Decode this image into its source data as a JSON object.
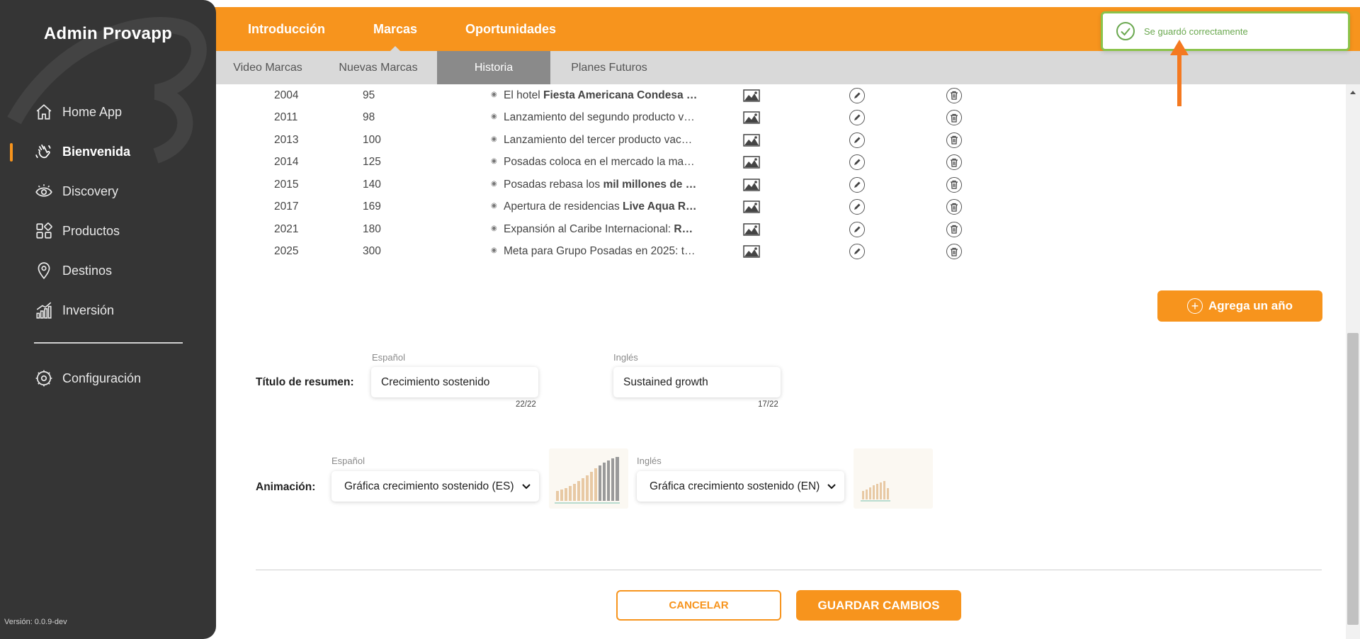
{
  "sidebar": {
    "brand": "Admin Provapp",
    "items": [
      {
        "label": "Home App",
        "icon": "home-icon"
      },
      {
        "label": "Bienvenida",
        "icon": "waving-hand-icon",
        "active": true
      },
      {
        "label": "Discovery",
        "icon": "eye-icon"
      },
      {
        "label": "Productos",
        "icon": "grid-icon"
      },
      {
        "label": "Destinos",
        "icon": "map-pin-icon"
      },
      {
        "label": "Inversión",
        "icon": "bar-chart-icon"
      }
    ],
    "config_label": "Configuración",
    "version": "Versión: 0.0.9-dev"
  },
  "header": {
    "tabs": [
      "Introducción",
      "Marcas",
      "Oportunidades"
    ],
    "active_tab": "Marcas",
    "subtabs": [
      "Video Marcas",
      "Nuevas Marcas",
      "Historia",
      "Planes Futuros"
    ],
    "active_subtab": "Historia"
  },
  "toast": {
    "message": "Se guardó correctamente",
    "color": "#8bc34a"
  },
  "timeline": [
    {
      "year": "2004",
      "value": "95",
      "text_plain": "El hotel ",
      "text_bold": "Fiesta Americana Condesa …"
    },
    {
      "year": "2011",
      "value": "98",
      "text_plain": "Lanzamiento del segundo producto v…",
      "text_bold": ""
    },
    {
      "year": "2013",
      "value": "100",
      "text_plain": "Lanzamiento del tercer producto vac…",
      "text_bold": ""
    },
    {
      "year": "2014",
      "value": "125",
      "text_plain": "Posadas coloca en el mercado la ma…",
      "text_bold": ""
    },
    {
      "year": "2015",
      "value": "140",
      "text_plain": "Posadas rebasa los ",
      "text_bold": "mil millones de …"
    },
    {
      "year": "2017",
      "value": "169",
      "text_plain": "Apertura de residencias ",
      "text_bold": "Live Aqua R…"
    },
    {
      "year": "2021",
      "value": "180",
      "text_plain": "Expansión al Caribe Internacional: ",
      "text_bold": "R…"
    },
    {
      "year": "2025",
      "value": "300",
      "text_plain": "Meta para Grupo Posadas en 2025: t…",
      "text_bold": ""
    }
  ],
  "add_year_label": "Agrega un año",
  "summary": {
    "label": "Título de resumen:",
    "es_label": "Español",
    "es_value": "Crecimiento sostenido",
    "es_count": "22/22",
    "en_label": "Inglés",
    "en_value": "Sustained growth",
    "en_count": "17/22"
  },
  "animation": {
    "label": "Animación:",
    "es_label": "Español",
    "es_selected": "Gráfica crecimiento sostenido (ES)",
    "en_label": "Inglés",
    "en_selected": "Gráfica crecimiento sostenido (EN)"
  },
  "actions": {
    "cancel": "CANCELAR",
    "save": "GUARDAR CAMBIOS"
  },
  "colors": {
    "accent": "#f7941d",
    "sidebar": "#353535",
    "success": "#8bc34a"
  }
}
